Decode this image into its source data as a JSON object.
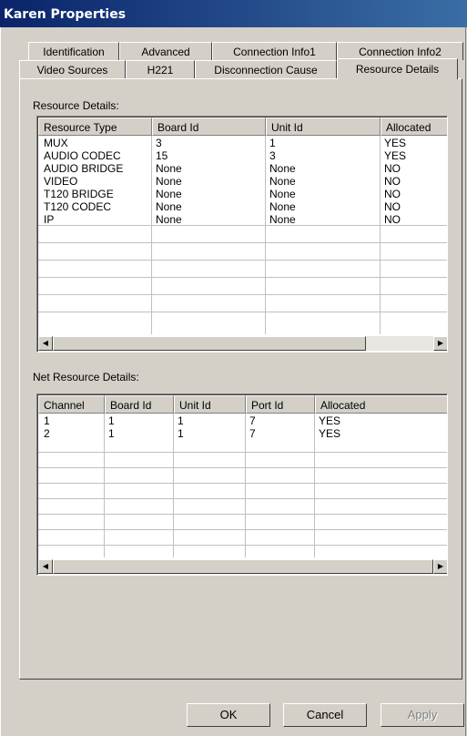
{
  "window": {
    "title": "Karen Properties"
  },
  "tabs_row1": [
    "Identification",
    "Advanced",
    "Connection Info1",
    "Connection Info2"
  ],
  "tabs_row2": [
    "Video Sources",
    "H221",
    "Disconnection Cause",
    "Resource Details"
  ],
  "active_tab": "Resource Details",
  "resource_details": {
    "label": "Resource Details:",
    "columns": [
      "Resource Type",
      "Board Id",
      "Unit Id",
      "Allocated"
    ],
    "rows": [
      [
        "MUX",
        "3",
        "1",
        "YES"
      ],
      [
        "AUDIO CODEC",
        "15",
        "3",
        "YES"
      ],
      [
        "AUDIO BRIDGE",
        "None",
        "None",
        "NO"
      ],
      [
        "VIDEO",
        "None",
        "None",
        "NO"
      ],
      [
        "T120 BRIDGE",
        "None",
        "None",
        "NO"
      ],
      [
        "T120 CODEC",
        "None",
        "None",
        "NO"
      ],
      [
        "IP",
        "None",
        "None",
        "NO"
      ]
    ]
  },
  "net_resource_details": {
    "label": "Net Resource Details:",
    "columns": [
      "Channel",
      "Board Id",
      "Unit Id",
      "Port Id",
      "Allocated"
    ],
    "rows": [
      [
        "1",
        "1",
        "1",
        "7",
        "YES"
      ],
      [
        "2",
        "1",
        "1",
        "7",
        "YES"
      ]
    ]
  },
  "buttons": {
    "ok": "OK",
    "cancel": "Cancel",
    "apply": "Apply"
  },
  "scroll_icons": {
    "left": "◀",
    "right": "▶"
  }
}
